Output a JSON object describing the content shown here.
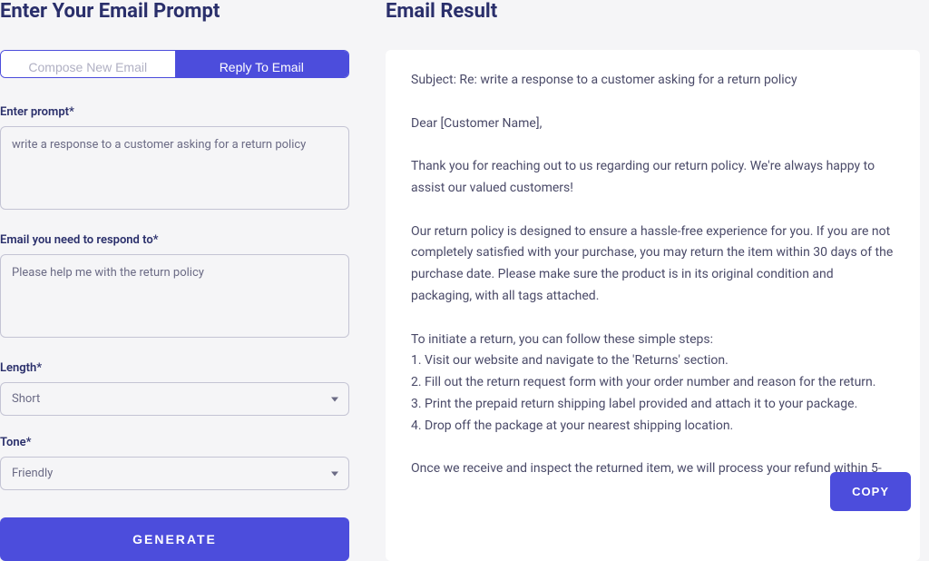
{
  "left": {
    "title": "Enter Your Email Prompt",
    "tabs": {
      "compose": "Compose New Email",
      "reply": "Reply To Email"
    },
    "prompt": {
      "label": "Enter prompt*",
      "value": "write a response to a customer asking for a return policy"
    },
    "respond_to": {
      "label": "Email you need to respond to*",
      "value": "Please help me with the return policy"
    },
    "length": {
      "label": "Length*",
      "value": "Short"
    },
    "tone": {
      "label": "Tone*",
      "value": "Friendly"
    },
    "generate": "GENERATE"
  },
  "right": {
    "title": "Email Result",
    "body": "Subject: Re: write a response to a customer asking for a return policy\n\nDear [Customer Name],\n\nThank you for reaching out to us regarding our return policy. We're always happy to assist our valued customers!\n\nOur return policy is designed to ensure a hassle-free experience for you. If you are not completely satisfied with your purchase, you may return the item within 30 days of the purchase date. Please make sure the product is in its original condition and packaging, with all tags attached.\n\nTo initiate a return, you can follow these simple steps:\n1. Visit our website and navigate to the 'Returns' section.\n2. Fill out the return request form with your order number and reason for the return.\n3. Print the prepaid return shipping label provided and attach it to your package.\n4. Drop off the package at your nearest shipping location.\n\nOnce we receive and inspect the returned item, we will process your refund within 5-",
    "copy": "COPY"
  }
}
